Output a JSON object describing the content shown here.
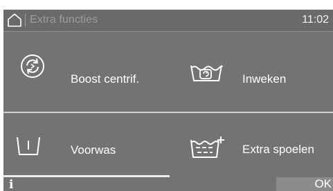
{
  "header": {
    "home_icon": "home-icon",
    "title": "Extra functies",
    "time": "11:02"
  },
  "options": [
    {
      "label": "Boost centrif.",
      "icon": "boost-spin-icon"
    },
    {
      "label": "Inweken",
      "icon": "soak-icon"
    },
    {
      "label": "Voorwas",
      "icon": "prewash-icon"
    },
    {
      "label": "Extra spoelen",
      "icon": "extra-rinse-icon"
    }
  ],
  "footer": {
    "info_label": "i",
    "ok_label": "OK"
  },
  "colors": {
    "screen_bg": "#737373",
    "header_bg": "#6a6a6a",
    "text": "#ffffff",
    "title_dim": "#9d9d9d",
    "ok_bg": "#8c8c8c"
  }
}
